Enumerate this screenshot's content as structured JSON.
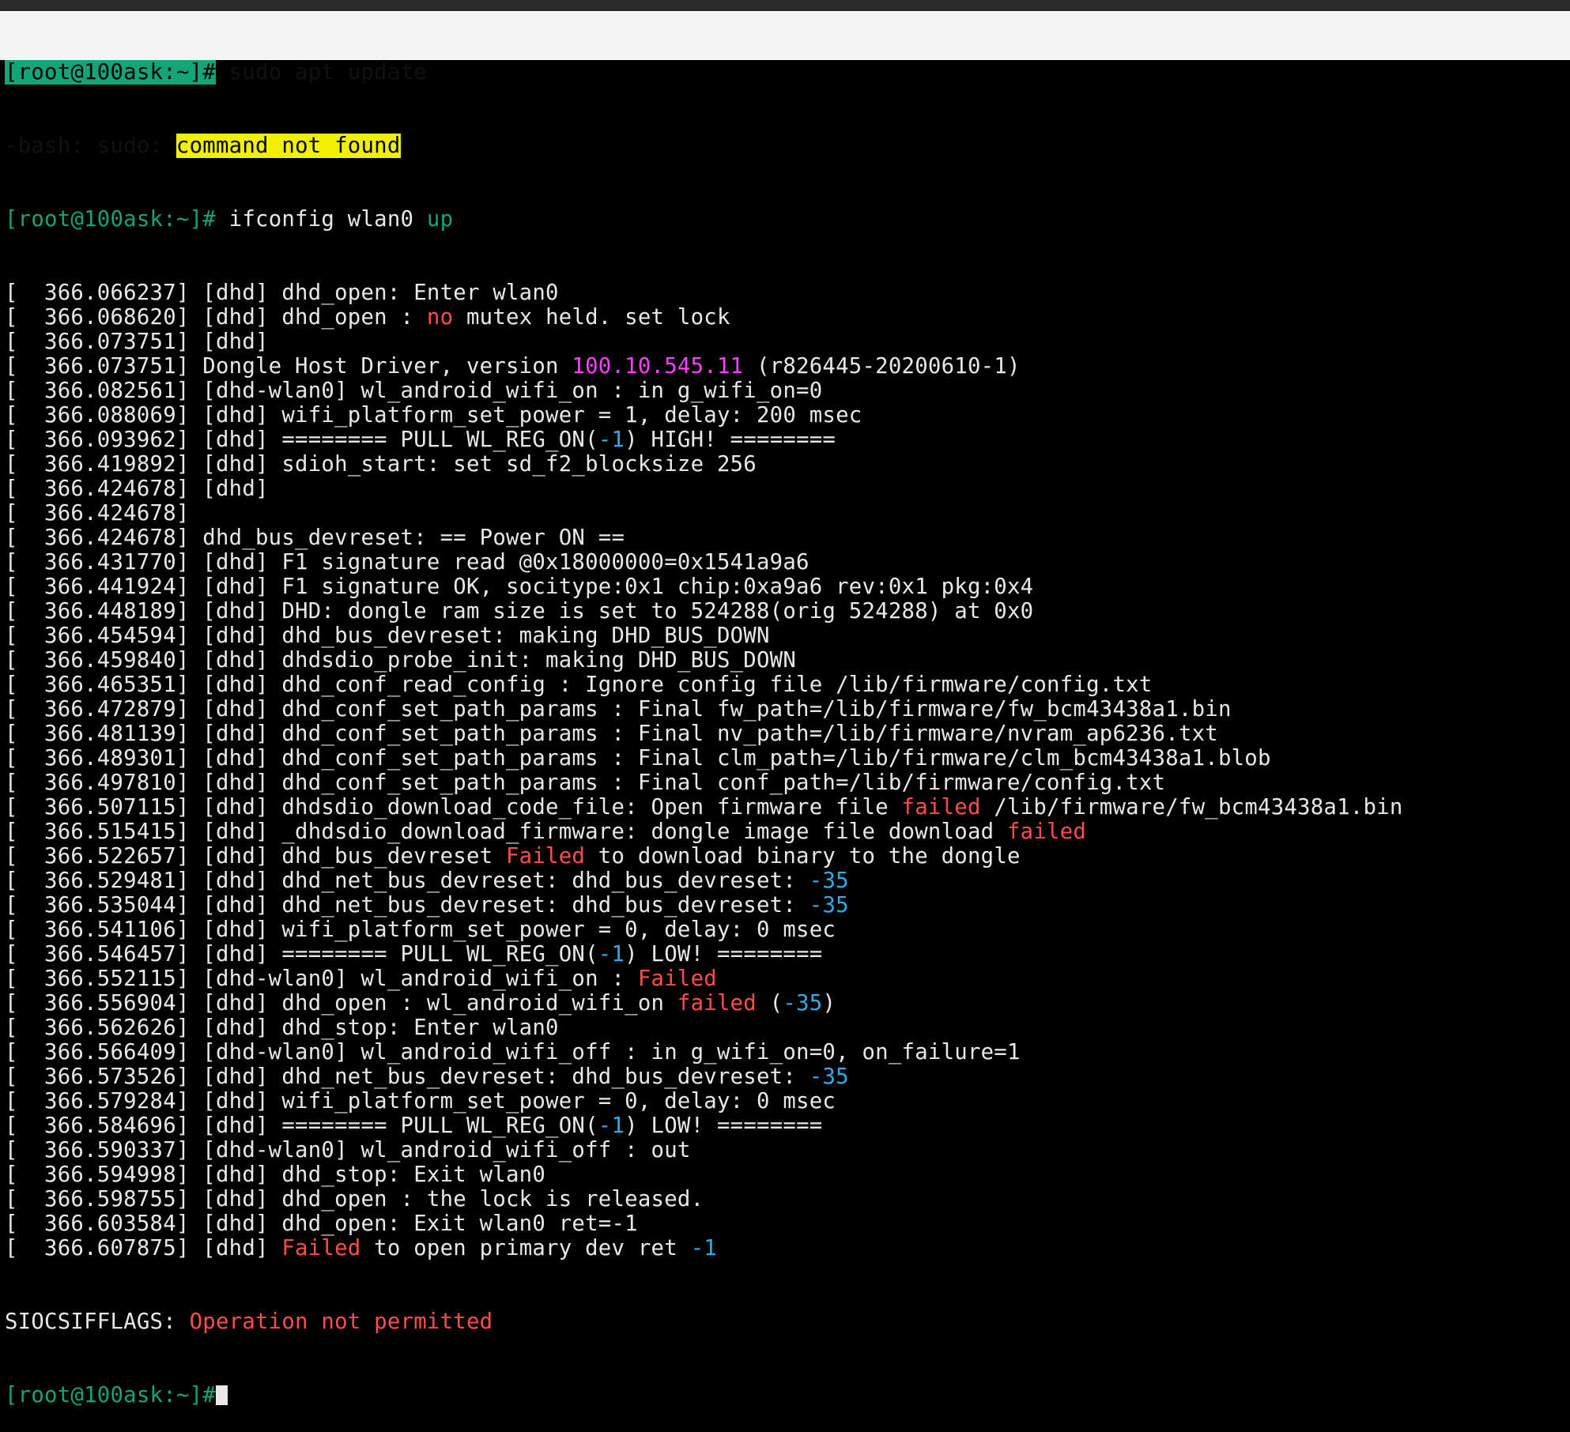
{
  "terminal": {
    "line1": {
      "prompt": "[root@100ask:~]#",
      "command": " sudo apt update"
    },
    "line2": {
      "prefix": "-bash: sudo: ",
      "highlight": "command not found"
    },
    "line3": {
      "prompt": "[root@100ask:~]#",
      "command": " ifconfig wlan0 ",
      "arg": "up"
    },
    "log": [
      {
        "ts": "[  366.066237]",
        "text": " [dhd] dhd_open: Enter wlan0"
      },
      {
        "ts": "[  366.068620]",
        "text": " [dhd] dhd_open : ",
        "hl": "no",
        "hl_color": "red",
        "tail": " mutex held. set lock"
      },
      {
        "ts": "[  366.073751]",
        "text": " [dhd]"
      },
      {
        "ts": "[  366.073751]",
        "text": " Dongle Host Driver, version ",
        "hl": "100.10.545.11",
        "hl_color": "magenta",
        "tail": " (r826445-20200610-1)"
      },
      {
        "ts": "[  366.082561]",
        "text": " [dhd-wlan0] wl_android_wifi_on : in g_wifi_on=0"
      },
      {
        "ts": "[  366.088069]",
        "text": " [dhd] wifi_platform_set_power = 1, delay: 200 msec"
      },
      {
        "ts": "[  366.093962]",
        "text": " [dhd] ======== PULL WL_REG_ON(",
        "hl": "-1",
        "hl_color": "blue",
        "tail": ") HIGH! ========"
      },
      {
        "ts": "[  366.419892]",
        "text": " [dhd] sdioh_start: set sd_f2_blocksize 256"
      },
      {
        "ts": "[  366.424678]",
        "text": " [dhd]"
      },
      {
        "ts": "[  366.424678]",
        "text": ""
      },
      {
        "ts": "[  366.424678]",
        "text": " dhd_bus_devreset: == Power ON =="
      },
      {
        "ts": "[  366.431770]",
        "text": " [dhd] F1 signature read @0x18000000=0x1541a9a6"
      },
      {
        "ts": "[  366.441924]",
        "text": " [dhd] F1 signature OK, socitype:0x1 chip:0xa9a6 rev:0x1 pkg:0x4"
      },
      {
        "ts": "[  366.448189]",
        "text": " [dhd] DHD: dongle ram size is set to 524288(orig 524288) at 0x0"
      },
      {
        "ts": "[  366.454594]",
        "text": " [dhd] dhd_bus_devreset: making DHD_BUS_DOWN"
      },
      {
        "ts": "[  366.459840]",
        "text": " [dhd] dhdsdio_probe_init: making DHD_BUS_DOWN"
      },
      {
        "ts": "[  366.465351]",
        "text": " [dhd] dhd_conf_read_config : Ignore config file /lib/firmware/config.txt"
      },
      {
        "ts": "[  366.472879]",
        "text": " [dhd] dhd_conf_set_path_params : Final fw_path=/lib/firmware/fw_bcm43438a1.bin"
      },
      {
        "ts": "[  366.481139]",
        "text": " [dhd] dhd_conf_set_path_params : Final nv_path=/lib/firmware/nvram_ap6236.txt"
      },
      {
        "ts": "[  366.489301]",
        "text": " [dhd] dhd_conf_set_path_params : Final clm_path=/lib/firmware/clm_bcm43438a1.blob"
      },
      {
        "ts": "[  366.497810]",
        "text": " [dhd] dhd_conf_set_path_params : Final conf_path=/lib/firmware/config.txt"
      },
      {
        "ts": "[  366.507115]",
        "text": " [dhd] dhdsdio_download_code_file: Open firmware file ",
        "hl": "failed",
        "hl_color": "red",
        "tail": " /lib/firmware/fw_bcm43438a1.bin"
      },
      {
        "ts": "[  366.515415]",
        "text": " [dhd] _dhdsdio_download_firmware: dongle image file download ",
        "hl": "failed",
        "hl_color": "red",
        "tail": ""
      },
      {
        "ts": "[  366.522657]",
        "text": " [dhd] dhd_bus_devreset ",
        "hl": "Failed",
        "hl_color": "red",
        "tail": " to download binary to the dongle"
      },
      {
        "ts": "[  366.529481]",
        "text": " [dhd] dhd_net_bus_devreset: dhd_bus_devreset: ",
        "hl": "-35",
        "hl_color": "blue",
        "tail": ""
      },
      {
        "ts": "[  366.535044]",
        "text": " [dhd] dhd_net_bus_devreset: dhd_bus_devreset: ",
        "hl": "-35",
        "hl_color": "blue",
        "tail": ""
      },
      {
        "ts": "[  366.541106]",
        "text": " [dhd] wifi_platform_set_power = 0, delay: 0 msec"
      },
      {
        "ts": "[  366.546457]",
        "text": " [dhd] ======== PULL WL_REG_ON(",
        "hl": "-1",
        "hl_color": "blue",
        "tail": ") LOW! ========"
      },
      {
        "ts": "[  366.552115]",
        "text": " [dhd-wlan0] wl_android_wifi_on : ",
        "hl": "Failed",
        "hl_color": "red",
        "tail": ""
      },
      {
        "ts": "[  366.556904]",
        "text": " [dhd] dhd_open : wl_android_wifi_on ",
        "hl": "failed",
        "hl_color": "red",
        "tail": " (",
        "hl2": "-35",
        "hl2_color": "blue",
        "tail2": ")"
      },
      {
        "ts": "[  366.562626]",
        "text": " [dhd] dhd_stop: Enter wlan0"
      },
      {
        "ts": "[  366.566409]",
        "text": " [dhd-wlan0] wl_android_wifi_off : in g_wifi_on=0, on_failure=1"
      },
      {
        "ts": "[  366.573526]",
        "text": " [dhd] dhd_net_bus_devreset: dhd_bus_devreset: ",
        "hl": "-35",
        "hl_color": "blue",
        "tail": ""
      },
      {
        "ts": "[  366.579284]",
        "text": " [dhd] wifi_platform_set_power = 0, delay: 0 msec"
      },
      {
        "ts": "[  366.584696]",
        "text": " [dhd] ======== PULL WL_REG_ON(",
        "hl": "-1",
        "hl_color": "blue",
        "tail": ") LOW! ========"
      },
      {
        "ts": "[  366.590337]",
        "text": " [dhd-wlan0] wl_android_wifi_off : out"
      },
      {
        "ts": "[  366.594998]",
        "text": " [dhd] dhd_stop: Exit wlan0"
      },
      {
        "ts": "[  366.598755]",
        "text": " [dhd] dhd_open : the lock is released."
      },
      {
        "ts": "[  366.603584]",
        "text": " [dhd] dhd_open: Exit wlan0 ret=-1"
      },
      {
        "ts": "[  366.607875]",
        "text": " [dhd] ",
        "hl": "Failed",
        "hl_color": "red",
        "tail": " to open primary dev ret ",
        "hl2": "-1",
        "hl2_color": "blue",
        "tail2": ""
      }
    ],
    "error_line": {
      "prefix": "SIOCSIFFLAGS: ",
      "message": "Operation not permitted"
    },
    "final_prompt": "[root@100ask:~]#"
  },
  "colors": {
    "background": "#000000",
    "foreground": "#e8e8e8",
    "prompt_green": "#13a478",
    "error_red": "#ff4d4d",
    "number_blue": "#35a8e8",
    "version_magenta": "#ff40ff",
    "highlight_yellow": "#f0f000",
    "selection_white": "#f4f4f4"
  }
}
